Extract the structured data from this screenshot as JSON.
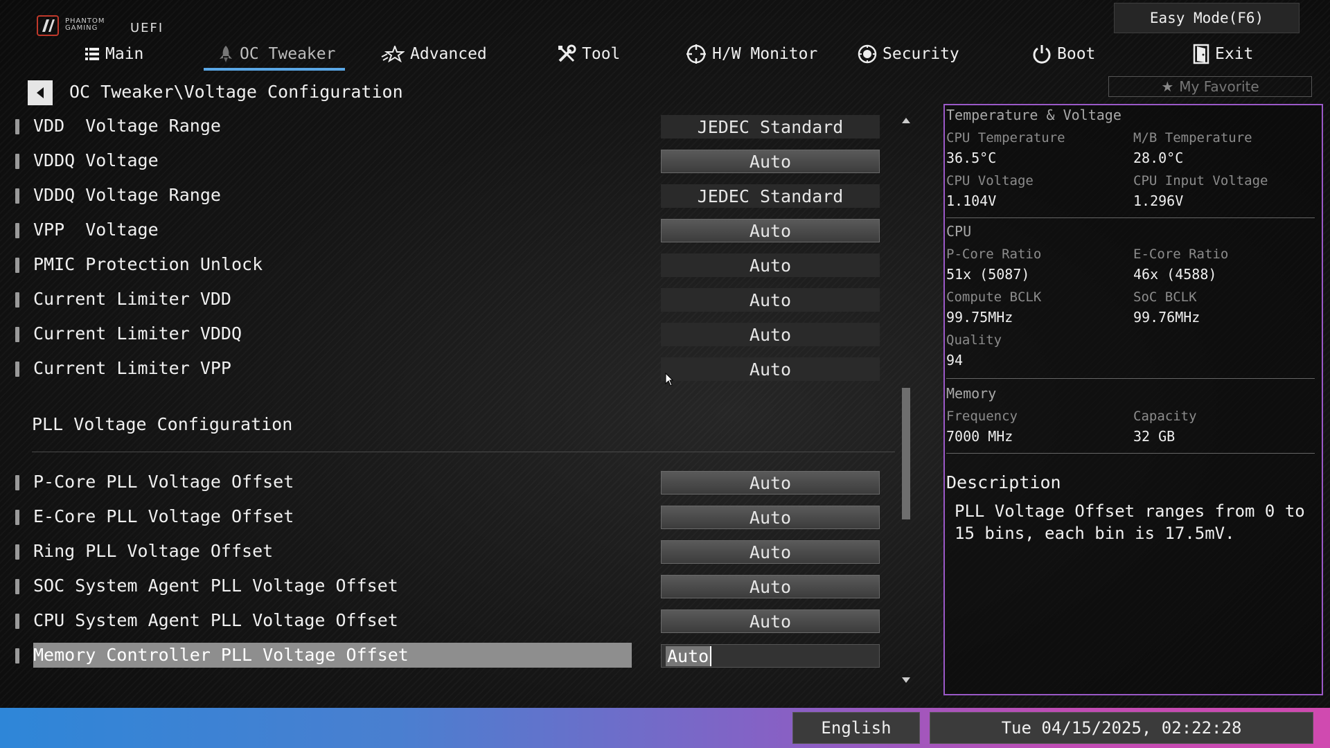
{
  "logo": {
    "brand_line1": "PHANTOM",
    "brand_line2": "GAMING",
    "uefi": "UEFI"
  },
  "easy_mode_label": "Easy Mode(F6)",
  "nav": [
    {
      "label": "Main",
      "icon": "list-icon"
    },
    {
      "label": "OC Tweaker",
      "icon": "rocket-icon",
      "active": true
    },
    {
      "label": "Advanced",
      "icon": "star-icon"
    },
    {
      "label": "Tool",
      "icon": "tools-icon"
    },
    {
      "label": "H/W Monitor",
      "icon": "crosshair-icon"
    },
    {
      "label": "Security",
      "icon": "shield-icon"
    },
    {
      "label": "Boot",
      "icon": "power-icon"
    },
    {
      "label": "Exit",
      "icon": "door-icon"
    }
  ],
  "favorite_label": "My Favorite",
  "breadcrumb": "OC Tweaker\\Voltage Configuration",
  "settings_top": [
    {
      "label": "VDD  Voltage Range",
      "value": "JEDEC Standard",
      "style": "dark"
    },
    {
      "label": "VDDQ Voltage",
      "value": "Auto",
      "style": "light"
    },
    {
      "label": "VDDQ Voltage Range",
      "value": "JEDEC Standard",
      "style": "dark"
    },
    {
      "label": "VPP  Voltage",
      "value": "Auto",
      "style": "light"
    },
    {
      "label": "PMIC Protection Unlock",
      "value": "Auto",
      "style": "dark"
    },
    {
      "label": "Current Limiter VDD",
      "value": "Auto",
      "style": "dark"
    },
    {
      "label": "Current Limiter VDDQ",
      "value": "Auto",
      "style": "dark"
    },
    {
      "label": "Current Limiter VPP",
      "value": "Auto",
      "style": "dark"
    }
  ],
  "section_title": "PLL Voltage Configuration",
  "settings_pll": [
    {
      "label": "P-Core PLL Voltage Offset",
      "value": "Auto",
      "style": "light"
    },
    {
      "label": "E-Core PLL Voltage Offset",
      "value": "Auto",
      "style": "light"
    },
    {
      "label": "Ring PLL Voltage Offset",
      "value": "Auto",
      "style": "light"
    },
    {
      "label": "SOC System Agent PLL Voltage Offset",
      "value": "Auto",
      "style": "light"
    },
    {
      "label": "CPU System Agent PLL Voltage Offset",
      "value": "Auto",
      "style": "light"
    },
    {
      "label": "Memory Controller PLL Voltage Offset",
      "value": "Auto",
      "style": "edit",
      "selected": true
    }
  ],
  "monitor": {
    "temp_voltage_title": "Temperature & Voltage",
    "cpu_temp_label": "CPU Temperature",
    "cpu_temp": "36.5°C",
    "mb_temp_label": "M/B Temperature",
    "mb_temp": "28.0°C",
    "cpu_voltage_label": "CPU Voltage",
    "cpu_voltage": "1.104V",
    "cpu_input_voltage_label": "CPU Input Voltage",
    "cpu_input_voltage": "1.296V",
    "cpu_title": "CPU",
    "pcore_ratio_label": "P-Core Ratio",
    "pcore_ratio": "51x (5087)",
    "ecore_ratio_label": "E-Core Ratio",
    "ecore_ratio": "46x (4588)",
    "compute_bclk_label": "Compute BCLK",
    "compute_bclk": "99.75MHz",
    "soc_bclk_label": "SoC BCLK",
    "soc_bclk": "99.76MHz",
    "quality_label": "Quality",
    "quality": "94",
    "memory_title": "Memory",
    "frequency_label": "Frequency",
    "frequency": "7000 MHz",
    "capacity_label": "Capacity",
    "capacity": "32 GB",
    "description_title": "Description",
    "description_text": "PLL Voltage Offset ranges from 0 to 15 bins, each bin is 17.5mV."
  },
  "footer": {
    "language": "English",
    "datetime": "Tue 04/15/2025, 02:22:28"
  },
  "colors": {
    "accent": "#5aa7e6",
    "panel_border": "#9b59c8"
  }
}
